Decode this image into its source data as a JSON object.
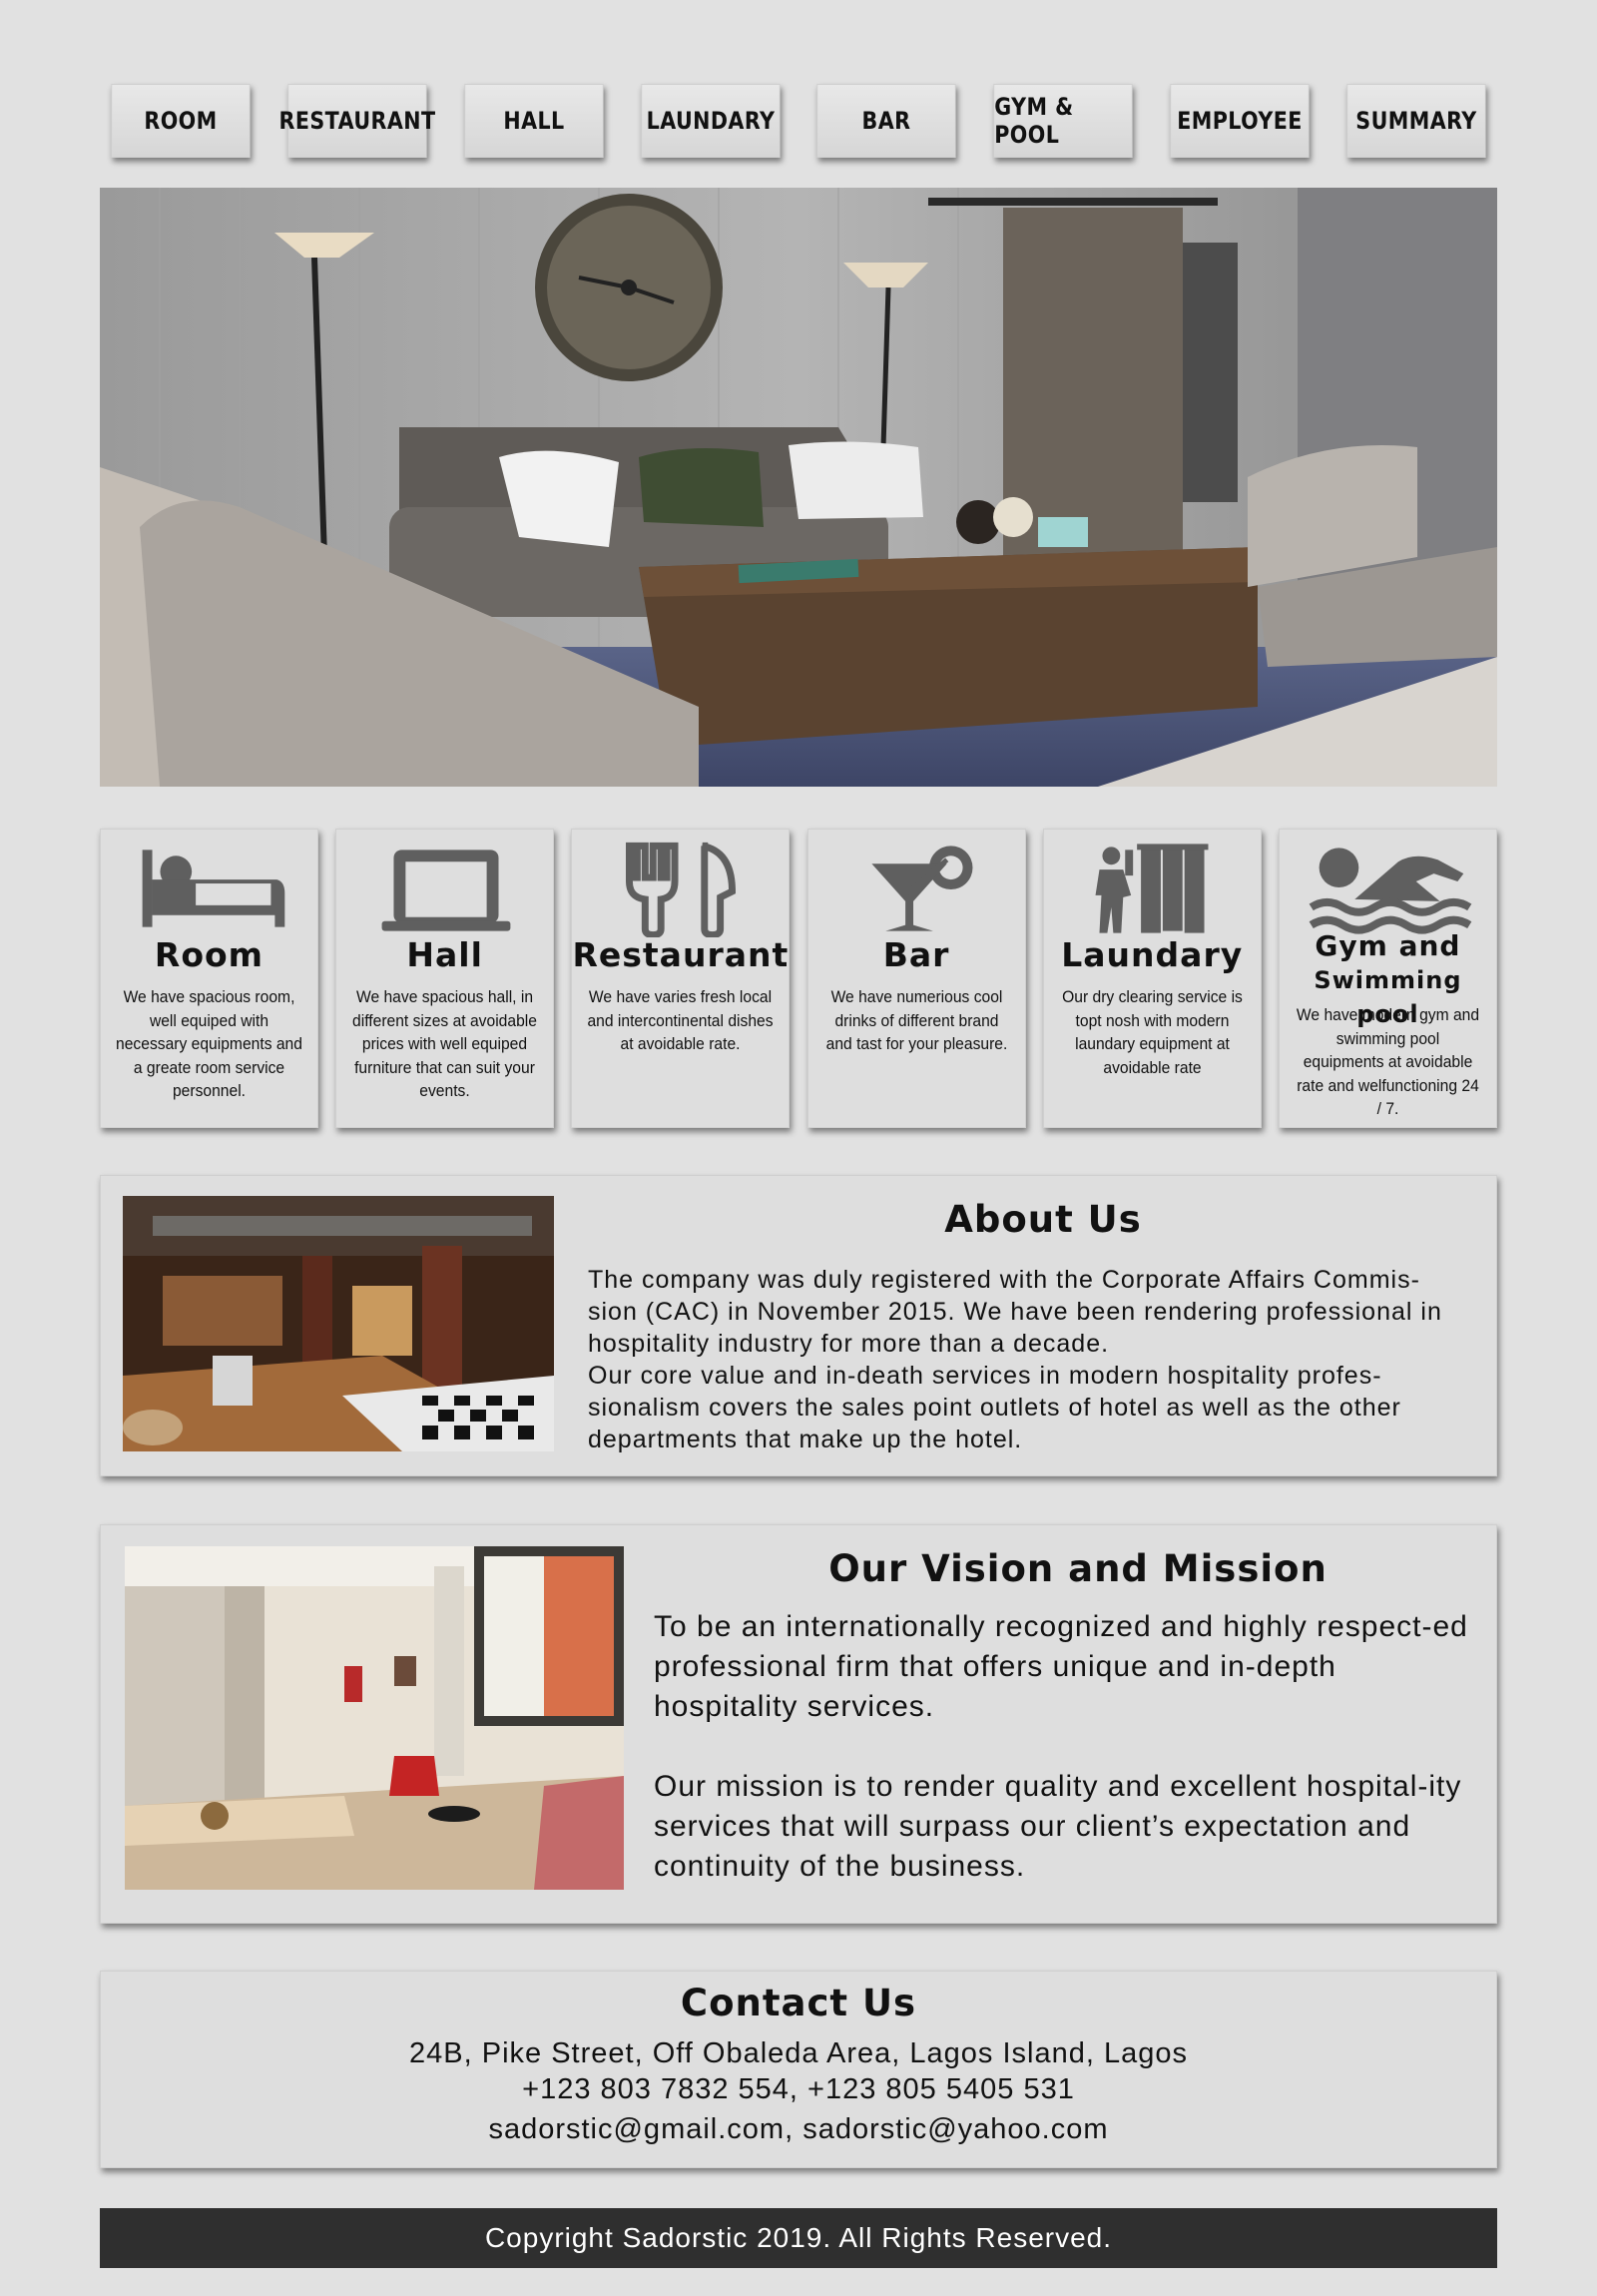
{
  "nav": {
    "items": [
      "ROOM",
      "RESTAURANT",
      "HALL",
      "LAUNDARY",
      "BAR",
      "GYM & POOL",
      "EMPLOYEE",
      "SUMMARY"
    ]
  },
  "hero": {
    "image": "living-room-photo"
  },
  "services": [
    {
      "icon": "bed-icon",
      "title": "Room",
      "desc": "We have spacious room, well equiped with necessary equipments and a greate room service personnel."
    },
    {
      "icon": "laptop-icon",
      "title": "Hall",
      "desc": "We have spacious hall, in different sizes at avoidable prices with well equiped furniture that can suit your events."
    },
    {
      "icon": "fork-knife-icon",
      "title": "Restaurant",
      "desc": "We have varies fresh local and intercontinental dishes at avoidable rate."
    },
    {
      "icon": "cocktail-icon",
      "title": "Bar",
      "desc": "We have numerious cool drinks of different brand and tast for your pleasure."
    },
    {
      "icon": "laundry-icon",
      "title": "Laundary",
      "desc": "Our dry clearing service is topt nosh with modern laundary equipment at avoidable rate"
    },
    {
      "icon": "swimmer-icon",
      "title": "Gym and",
      "subtitle": "Swimming pool",
      "desc": "We have modern gym and swimming pool equipments at avoidable rate and welfunctioning 24 / 7."
    }
  ],
  "about": {
    "title": "About Us",
    "text1": "The company was duly registered with the Corporate Affairs Commis-sion (CAC) in November 2015. We have been rendering professional in hospitality industry for more than a decade.",
    "text2": "Our core value and in-death services in modern hospitality profes-sionalism covers the sales point outlets of hotel as well as the other departments that make up the hotel."
  },
  "vision": {
    "title": "Our Vision and Mission",
    "vision_text": "To be an internationally recognized and highly respect-ed professional firm that offers unique and in-depth hospitality services.",
    "mission_text": "Our mission is to render quality and excellent hospital-ity services that will surpass our client’s expectation and continuity of the business."
  },
  "contact": {
    "title": "Contact Us",
    "address": "24B, Pike Street, Off Obaleda Area, Lagos Island, Lagos",
    "phones": "+123 803 7832 554,  +123 805 5405 531",
    "emails": "sadorstic@gmail.com, sadorstic@yahoo.com"
  },
  "footer": {
    "copyright": "Copyright Sadorstic 2019. All Rights Reserved."
  }
}
